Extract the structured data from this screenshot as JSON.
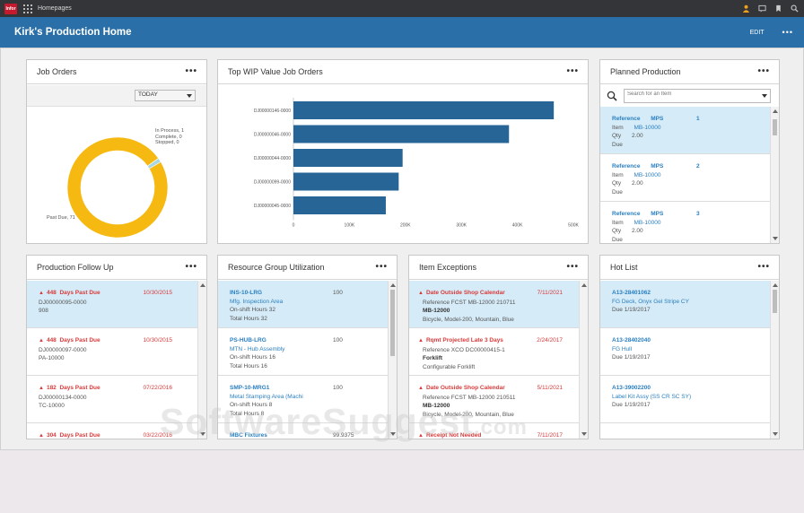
{
  "topbar": {
    "logo": "Infor",
    "title": "Homepages",
    "icons": [
      "user-icon",
      "chat-icon",
      "bookmark-icon",
      "search-icon"
    ]
  },
  "header": {
    "title": "Kirk's Production Home",
    "edit_label": "EDIT",
    "more": "•••"
  },
  "colors": {
    "header": "#2a6fa7",
    "donut_main": "#f6b912",
    "donut_small": "#a8d7e2",
    "bar": "#276597",
    "alert": "#d83b3b",
    "link": "#2a7fc0",
    "selected_row": "#d5ebf7"
  },
  "job_orders": {
    "title": "Job Orders",
    "more": "•••",
    "filter_value": "TODAY",
    "legend": [
      "In Process, 1",
      "Complete, 0",
      "Stopped, 0"
    ],
    "past_due_label": "Past Due, 71",
    "chart_data": {
      "type": "pie",
      "categories": [
        "In Process",
        "Complete",
        "Stopped",
        "Past Due"
      ],
      "values": [
        1,
        0,
        0,
        71
      ]
    }
  },
  "wip": {
    "title": "Top WIP Value Job Orders",
    "more": "•••",
    "chart_data": {
      "type": "bar",
      "orientation": "horizontal",
      "categories": [
        "DJ00000146-0000",
        "DJ00000046-0000",
        "DJ00000044-0000",
        "DJ00000099-0000",
        "DJ00000045-0000"
      ],
      "values": [
        465000,
        385000,
        195000,
        188000,
        165000
      ],
      "xlim": [
        0,
        500000
      ],
      "ticks": [
        "0",
        "100K",
        "200K",
        "300K",
        "400K",
        "500K"
      ]
    }
  },
  "planned": {
    "title": "Planned Production",
    "more": "•••",
    "search_placeholder": "Search for an Item",
    "items": [
      {
        "ref_label": "Reference",
        "ref_value": "MPS",
        "num": "1",
        "item_label": "Item",
        "item_value": "MB-10000",
        "qty_label": "Qty",
        "qty_value": "2.00",
        "due_label": "Due"
      },
      {
        "ref_label": "Reference",
        "ref_value": "MPS",
        "num": "2",
        "item_label": "Item",
        "item_value": "MB-10000",
        "qty_label": "Qty",
        "qty_value": "2.00",
        "due_label": "Due"
      },
      {
        "ref_label": "Reference",
        "ref_value": "MPS",
        "num": "3",
        "item_label": "Item",
        "item_value": "MB-10000",
        "qty_label": "Qty",
        "qty_value": "2.00",
        "due_label": "Due"
      }
    ]
  },
  "followup": {
    "title": "Production Follow Up",
    "more": "•••",
    "items": [
      {
        "days": "448",
        "status": "Days Past Due",
        "date": "10/30/2015",
        "order": "DJ00000095-0000",
        "code": "908"
      },
      {
        "days": "448",
        "status": "Days Past Due",
        "date": "10/30/2015",
        "order": "DJ00000097-0000",
        "code": "PA-10000"
      },
      {
        "days": "182",
        "status": "Days Past Due",
        "date": "07/22/2016",
        "order": "DJ00000134-0000",
        "code": "TC-10000"
      },
      {
        "days": "304",
        "status": "Days Past Due",
        "date": "03/22/2016",
        "order": "",
        "code": ""
      }
    ]
  },
  "resource": {
    "title": "Resource Group Utilization",
    "more": "•••",
    "items": [
      {
        "code": "INS-10-LRG",
        "value": "100",
        "name": "Mfg. Inspection Area",
        "shift": "On-shift Hours  32",
        "total": "Total Hours  32"
      },
      {
        "code": "PS-HUB-LRG",
        "value": "100",
        "name": "MTN - Hub Assembly",
        "shift": "On-shift Hours  16",
        "total": "Total Hours  16"
      },
      {
        "code": "SMP-10-MRG1",
        "value": "100",
        "name": "Metal Stamping Area (Machi",
        "shift": "On-shift Hours  8",
        "total": "Total Hours  8"
      },
      {
        "code": "MBC Fixtures",
        "value": "99.9375",
        "name": "",
        "shift": "",
        "total": ""
      }
    ]
  },
  "exceptions": {
    "title": "Item Exceptions",
    "more": "•••",
    "items": [
      {
        "status": "Date Outside Shop Calendar",
        "date": "7/11/2021",
        "ref": "Reference    FCST MB-12000 210711",
        "item": "MB-12000",
        "desc": "Bicycle, Model-200, Mountain, Blue"
      },
      {
        "status": "Rqmt Projected Late 3 Days",
        "date": "2/24/2017",
        "ref": "Reference    XCO DC00000415-1",
        "item": "Forklift",
        "desc": "Configurable Forklift"
      },
      {
        "status": "Date Outside Shop Calendar",
        "date": "5/11/2021",
        "ref": "Reference    FCST MB-12000 210511",
        "item": "MB-12000",
        "desc": "Bicycle, Model-200, Mountain, Blue"
      },
      {
        "status": "Receipt Not Needed",
        "date": "7/11/2017",
        "ref": "",
        "item": "",
        "desc": ""
      }
    ]
  },
  "hotlist": {
    "title": "Hot List",
    "more": "•••",
    "items": [
      {
        "code": "A13-28401062",
        "name": "FG Deck, Onyx Gel Stripe CY",
        "due": "Due    1/19/2017"
      },
      {
        "code": "A13-28402040",
        "name": "FG Hull",
        "due": "Due    1/19/2017"
      },
      {
        "code": "A13-39002200",
        "name": "Label Kit Assy (SS CR SC SY)",
        "due": "Due    1/19/2017"
      }
    ]
  },
  "watermark": {
    "text": "SoftwareSuggest",
    "suffix": ".com"
  }
}
